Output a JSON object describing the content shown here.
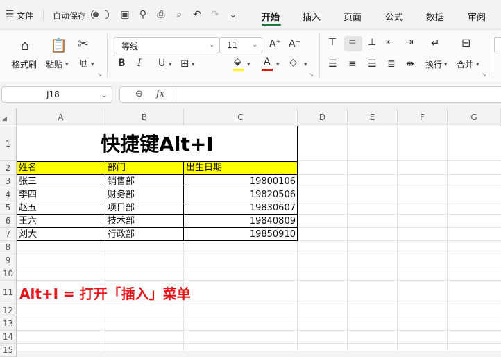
{
  "titlebar": {
    "file": "文件",
    "autosave": "自动保存",
    "tabs": [
      "开始",
      "插入",
      "页面",
      "公式",
      "数据",
      "审阅"
    ],
    "active_tab": "开始"
  },
  "ribbon": {
    "format_painter": "格式刷",
    "paste": "粘贴",
    "font_name": "等线",
    "font_size": "11",
    "wrap_text": "换行",
    "merge": "合并"
  },
  "formula_bar": {
    "cell_ref": "J18",
    "fx": "fx",
    "value": ""
  },
  "sheet": {
    "columns": [
      "A",
      "B",
      "C",
      "D",
      "E",
      "F",
      "G"
    ],
    "rows": [
      "1",
      "2",
      "3",
      "4",
      "5",
      "6",
      "7",
      "8",
      "9",
      "10",
      "11",
      "12",
      "13",
      "14",
      "15"
    ],
    "title": "快捷键Alt+I",
    "headers": [
      "姓名",
      "部门",
      "出生日期"
    ],
    "data_rows": [
      [
        "张三",
        "销售部",
        "19800106"
      ],
      [
        "李四",
        "财务部",
        "19820506"
      ],
      [
        "赵五",
        "项目部",
        "19830607"
      ],
      [
        "王六",
        "技术部",
        "19840809"
      ],
      [
        "刘大",
        "行政部",
        "19850910"
      ]
    ],
    "note": "Alt+I = 打开「插入」菜单"
  },
  "colors": {
    "header_fill": "#ffff00",
    "note_color": "#e8151b",
    "accent": "#1f7a3f"
  }
}
